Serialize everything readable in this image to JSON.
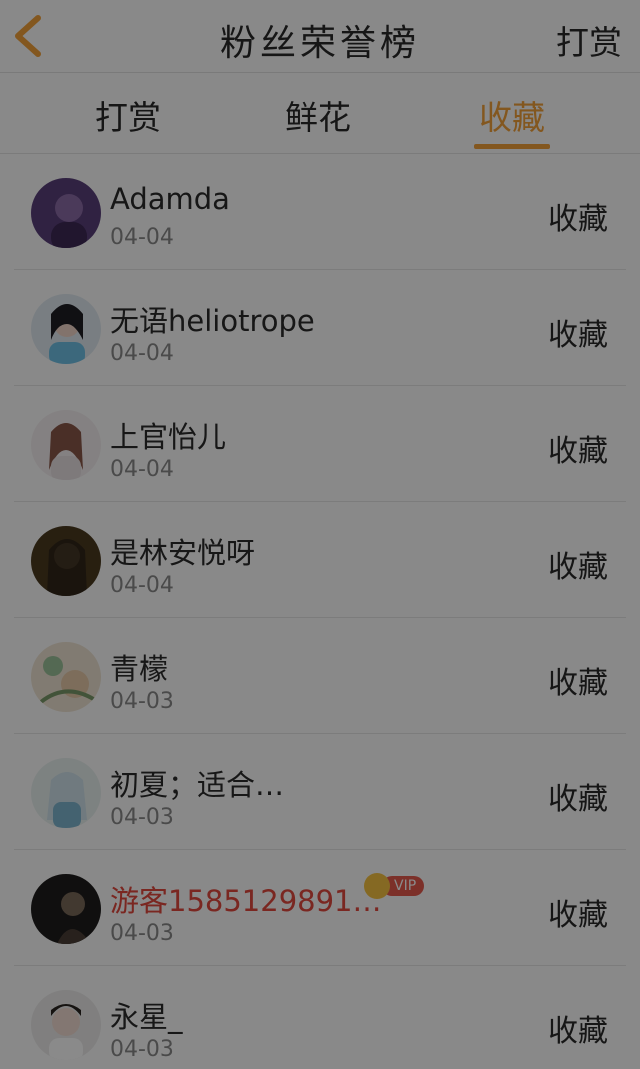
{
  "header": {
    "title": "粉丝荣誉榜",
    "right_label": "打赏"
  },
  "tabs": [
    {
      "label": "打赏",
      "active": false
    },
    {
      "label": "鲜花",
      "active": false
    },
    {
      "label": "收藏",
      "active": true
    }
  ],
  "colors": {
    "accent": "#f3a13a",
    "vip_name": "#e2483e",
    "vip_badge": "#e65a4d",
    "crown": "#f6c342"
  },
  "fans": [
    {
      "name": "Adamda",
      "date": "04-04",
      "action": "收藏"
    },
    {
      "name": "无语heliotrope",
      "date": "04-04",
      "action": "收藏"
    },
    {
      "name": "上官怡儿",
      "date": "04-04",
      "action": "收藏"
    },
    {
      "name": "是林安悦呀",
      "date": "04-04",
      "action": "收藏"
    },
    {
      "name": "青檬",
      "date": "04-03",
      "action": "收藏"
    },
    {
      "name": "初夏；适合…",
      "date": "04-03",
      "action": "收藏"
    },
    {
      "name": "游客1585129891…",
      "date": "04-03",
      "action": "收藏",
      "badge": "VIP"
    },
    {
      "name": "永星_",
      "date": "04-03",
      "action": "收藏"
    }
  ]
}
